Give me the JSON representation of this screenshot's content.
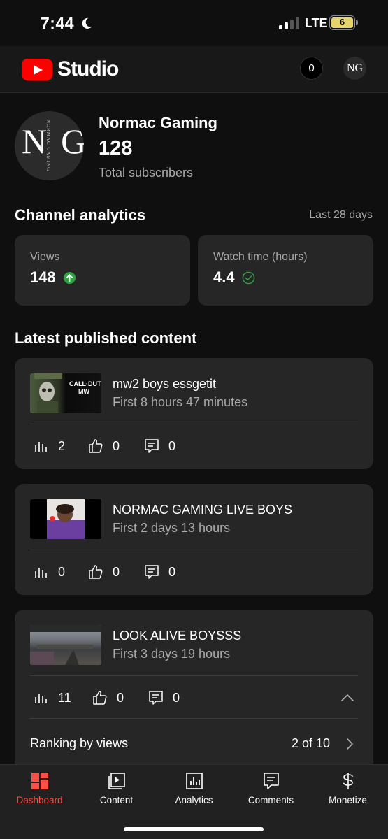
{
  "status_bar": {
    "time": "7:44",
    "network": "LTE",
    "battery": "6"
  },
  "header": {
    "app_name": "Studio",
    "notification_count": "0",
    "avatar_initials": "NG"
  },
  "channel": {
    "name": "Normac Gaming",
    "subscribers": "128",
    "subscribers_label": "Total subscribers",
    "avatar_text": "NORMAC GAMING"
  },
  "analytics": {
    "title": "Channel analytics",
    "period": "Last 28 days",
    "views_label": "Views",
    "views_value": "148",
    "watch_label": "Watch time (hours)",
    "watch_value": "4.4"
  },
  "content": {
    "title": "Latest published content",
    "videos": [
      {
        "title": "mw2 boys essgetit",
        "subtitle": "First 8 hours 47 minutes",
        "views": "2",
        "likes": "0",
        "comments": "0",
        "thumb_text": "CALL·DUTY MW"
      },
      {
        "title": "NORMAC GAMING LIVE BOYS",
        "subtitle": "First 2 days 13 hours",
        "views": "0",
        "likes": "0",
        "comments": "0"
      },
      {
        "title": "LOOK ALIVE BOYSSS",
        "subtitle": "First 3 days 19 hours",
        "views": "11",
        "likes": "0",
        "comments": "0",
        "ranking_label": "Ranking by views",
        "ranking_value": "2 of 10"
      }
    ]
  },
  "nav": {
    "items": [
      {
        "label": "Dashboard",
        "icon": "dashboard-icon",
        "active": true
      },
      {
        "label": "Content",
        "icon": "content-icon"
      },
      {
        "label": "Analytics",
        "icon": "analytics-icon"
      },
      {
        "label": "Comments",
        "icon": "comments-icon"
      },
      {
        "label": "Monetize",
        "icon": "monetize-icon"
      }
    ]
  },
  "colors": {
    "accent": "#ff4e45",
    "brand_red": "#ff0000",
    "positive": "#2ba640"
  }
}
